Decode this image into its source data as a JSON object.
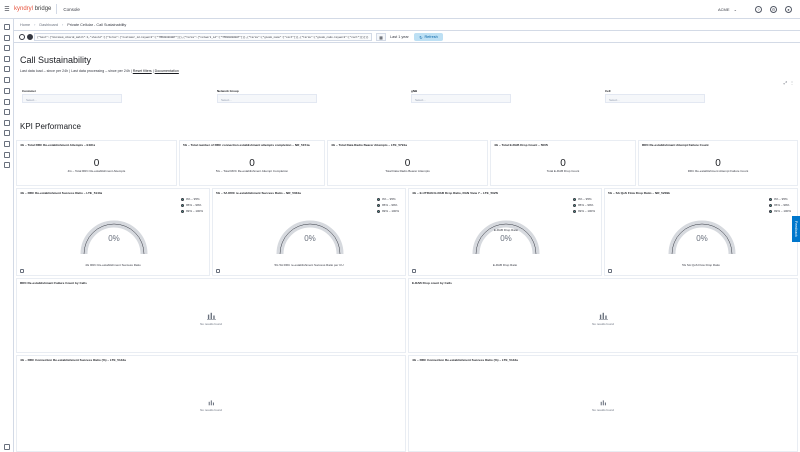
{
  "header": {
    "brand_left": "kyndryl",
    "brand_right": "bridge",
    "app_name": "Console",
    "space_name": "ACME",
    "icons": [
      "menu-icon",
      "help-icon",
      "settings-icon",
      "user-icon"
    ]
  },
  "breadcrumbs": [
    "Home",
    "Dashboard",
    "Private Cellular - Call Sustainability"
  ],
  "query": {
    "text": "{\"bool\":{\"minimum_should_match\":1,\"should\":[{\"terms\":{\"customer_id.keyword\":[\"TMO000000WT\"]}},{\"terms\":{\"network_id\":[\"TMO000000WT\"]}},{\"terms\":{\"gnode_name\":[\"cect\"]}},{\"terms\":{\"gnode_code.keyword\":[\"cect\"]}}]}}",
    "date_range": "Last 1 year",
    "refresh_label": "Refresh"
  },
  "page": {
    "title": "Call Sustainability",
    "subtitle_prefix": "Last data load – since per 24h | Last data processing – since per 24h |",
    "reset_link": "Reset filters",
    "doc_link": "Documentation"
  },
  "filters": [
    {
      "label": "Customer",
      "placeholder": "Select..."
    },
    {
      "label": "Network Group",
      "placeholder": "Select..."
    },
    {
      "label": "gNB",
      "placeholder": "Select..."
    },
    {
      "label": "Cell",
      "placeholder": "Select..."
    }
  ],
  "section_title": "KPI Performance",
  "metrics": [
    {
      "title": "4G – Total RRC Re-establishment Attempts – E181a",
      "value": "0",
      "label": "4G – Total RRC Re-establishment Attempts"
    },
    {
      "title": "5G – Total number of RRC connection establishment attempts completion – NR_5151a",
      "value": "0",
      "label": "5G – Total RRC Re-establishment Attempt Completion"
    },
    {
      "title": "4G – Total Data Radio Bearer Attempts – LTE_5791a",
      "value": "0",
      "label": "Total Data Radio Bearer Attempts"
    },
    {
      "title": "4G – Total E-RAB Drop Count – 5005i",
      "value": "0",
      "label": "Total E-RAB Drop Count"
    },
    {
      "title": "RRC Re-establishment Attempt Failure Count",
      "value": "0",
      "label": "RRC Re-establishment Attempt Failure Count"
    }
  ],
  "gauges": [
    {
      "title": "4G – RRC Re-establishment Success Ratio – LTE_5143a",
      "value": "0%",
      "center_label": "",
      "caption": "4G RRC Re-establishment Success Ratio",
      "legend": [
        "0% – 95%",
        "95% – 99%",
        "99% – 100%"
      ]
    },
    {
      "title": "5G – 5A RRC re-establishment Success Ratio – NR_5034a",
      "value": "0%",
      "center_label": "",
      "caption": "5G 5A RRC re-establishment Success Ratio per CU",
      "legend": [
        "0% – 95%",
        "95% – 99%",
        "99% – 100%"
      ]
    },
    {
      "title": "4G – E-UTRAN E-RAB Drop Ratio, RAN View 7 – LTE_5025i",
      "value": "0%",
      "center_label": "E-RAB Drop Ratio",
      "caption": "E-RAB Drop Ratio",
      "legend": [
        "0% – 95%",
        "95% – 99%",
        "99% – 100%"
      ]
    },
    {
      "title": "5G – SA QoS Flow Drop Ratio – NR_5209b",
      "value": "0%",
      "center_label": "",
      "caption": "5G SA QoS Flow Drop Ratio",
      "legend": [
        "0% – 95%",
        "95% – 99%",
        "99% – 100%"
      ]
    }
  ],
  "empty_panels": [
    {
      "title": "RRC Re-establishment Failure Count by Cells",
      "message": "No results found"
    },
    {
      "title": "E-RAB Drop count by Cells",
      "message": "No results found"
    },
    {
      "title": "4G – RRC Connection Re-establishment Success Ratio (%) – LTE_5143a",
      "message": "No results found"
    },
    {
      "title": "4G – RRC Connection Re-establishment Success Ratio (%) – LTE_5143a",
      "message": "No results found"
    }
  ],
  "feedback_label": "Feedback",
  "colors": {
    "brand": "#e7513b",
    "gauge_red": "#d6d9de",
    "refresh_bg": "#bde0f4",
    "feedback": "#0077cc"
  }
}
